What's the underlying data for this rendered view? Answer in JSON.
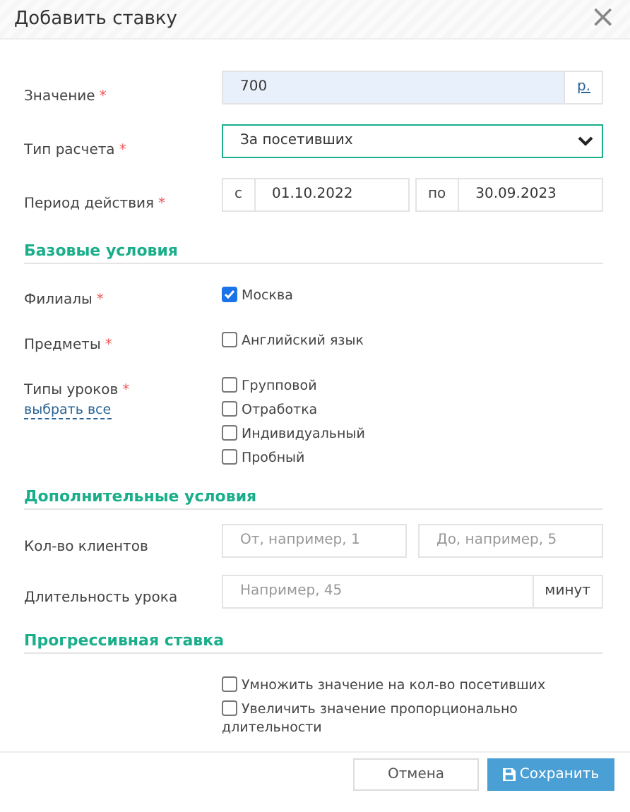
{
  "dialog": {
    "title": "Добавить ставку",
    "close": "×"
  },
  "main_fields": [
    {
      "kind": "unit",
      "label": "Значение",
      "required": "*",
      "value": "700",
      "unit": "р."
    },
    {
      "kind": "select",
      "label": "Тип расчета",
      "required": "*",
      "value": "За посетивших"
    },
    {
      "kind": "period",
      "label": "Период действия",
      "required": "*",
      "from_label": "с",
      "from": "01.10.2022",
      "to_label": "по",
      "to": "30.09.2023"
    }
  ],
  "sections": [
    {
      "title": "Базовые условия",
      "rows": [
        {
          "kind": "checks",
          "label": "Филиалы",
          "required": "*",
          "options": [
            {
              "label": "Москва",
              "checked": true
            }
          ]
        },
        {
          "kind": "checks",
          "label": "Предметы",
          "required": "*",
          "options": [
            {
              "label": "Английский язык",
              "checked": false
            }
          ]
        },
        {
          "kind": "checks",
          "label": "Типы уроков",
          "required": "*",
          "link": "выбрать все",
          "options": [
            {
              "label": "Групповой",
              "checked": false
            },
            {
              "label": "Отработка",
              "checked": false
            },
            {
              "label": "Индивидуальный",
              "checked": false
            },
            {
              "label": "Пробный",
              "checked": false
            }
          ]
        }
      ]
    },
    {
      "title": "Дополнительные условия",
      "rows": [
        {
          "kind": "range",
          "label": "Кол-во клиентов",
          "from_placeholder": "От, например, 1",
          "to_placeholder": "До, например, 5"
        },
        {
          "kind": "unit_input",
          "label": "Длительность урока",
          "placeholder": "Например, 45",
          "unit": "минут"
        }
      ]
    },
    {
      "title": "Прогрессивная ставка",
      "rows": [
        {
          "kind": "checks",
          "options": [
            {
              "label": "Умножить значение на кол-во посетивших",
              "checked": false
            },
            {
              "label": "Увеличить значение пропорционально длительности",
              "checked": false
            }
          ]
        }
      ]
    }
  ],
  "buttons": [
    {
      "kind": "secondary",
      "label": "Отмена"
    },
    {
      "kind": "primary",
      "label": "Сохранить"
    }
  ]
}
